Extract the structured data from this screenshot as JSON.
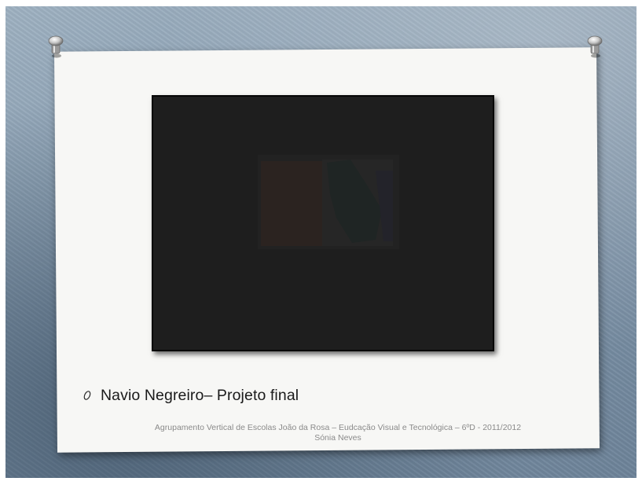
{
  "slide": {
    "caption": "Navio Negreiro– Projeto final",
    "footer_line1": "Agrupamento Vertical de Escolas João da Rosa  – Eudcação Visual e Tecnológica – 6ºD -  2011/2012",
    "footer_line2": "Sónia Neves"
  },
  "icons": {
    "bullet": "circle-bullet-icon",
    "pins": "pushpin-icon"
  },
  "colors": {
    "background": "#8499ad",
    "card": "#f7f7f5",
    "video_frame": "#1e1e1e",
    "caption_text": "#1a1a1a",
    "footer_text": "#8a8a8a"
  }
}
